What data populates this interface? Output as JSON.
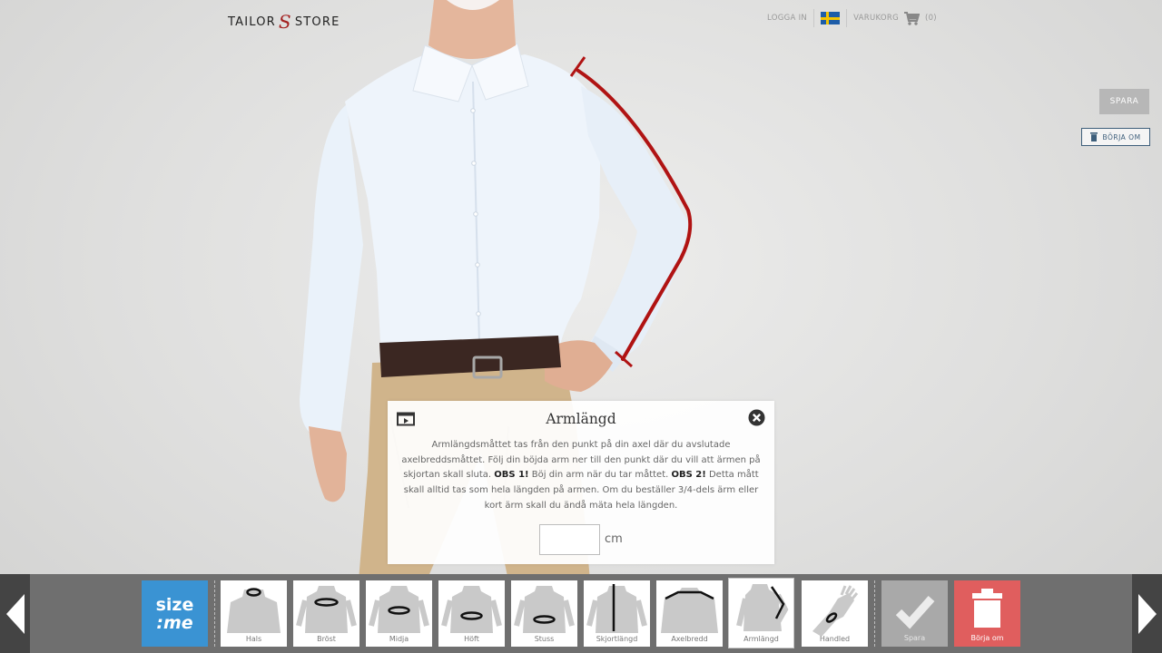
{
  "header": {
    "logo_left": "TAILOR",
    "logo_mono": "S",
    "logo_right": "STORE",
    "login": "LOGGA IN",
    "flag_icon": "swedish-flag-icon",
    "cart_label": "VARUKORG",
    "cart_count": "(0)"
  },
  "side": {
    "save_label": "SPARA",
    "reset_label": "BÖRJA OM"
  },
  "dialog": {
    "title": "Armlängd",
    "text_1": "Armlängdsmåttet tas från den punkt på din axel där du avslutade axelbreddsmåttet. Följ din böjda arm ner till den punkt där du vill att ärmen på skjortan skall sluta. ",
    "obs_1": "OBS 1!",
    "text_2": " Böj din arm när du tar måttet. ",
    "obs_2": "OBS 2!",
    "text_3": " Detta mått skall alltid tas som hela längden på armen. Om du beställer 3/4-dels ärm eller kort ärm skall du ändå mäta hela längden.",
    "input_value": "",
    "unit": "cm"
  },
  "bottombar": {
    "sizeme_line1": "size",
    "sizeme_line2": ":me",
    "items": [
      {
        "label": "Hals"
      },
      {
        "label": "Bröst"
      },
      {
        "label": "Midja"
      },
      {
        "label": "Höft"
      },
      {
        "label": "Stuss"
      },
      {
        "label": "Skjortlängd"
      },
      {
        "label": "Axelbredd"
      },
      {
        "label": "Armlängd"
      },
      {
        "label": "Handled"
      }
    ],
    "active_index": 7,
    "save_label": "Spara",
    "reset_label": "Börja om"
  },
  "colors": {
    "measure_line": "#b01313",
    "sizeme_blue": "#3a93d3",
    "reset_red": "#e05e5e",
    "save_gray": "#a9a9a9"
  }
}
